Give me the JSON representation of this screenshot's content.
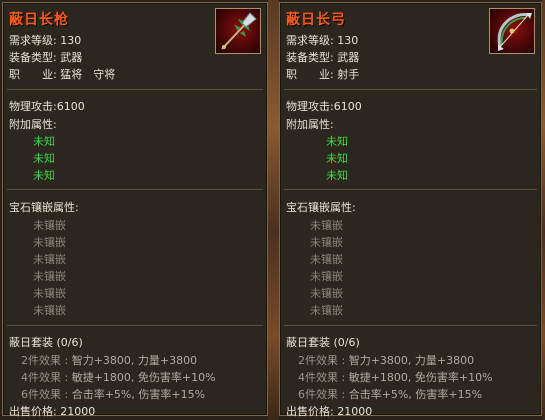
{
  "left": {
    "title": "蔽日长枪",
    "req_label": "需求等级:",
    "req_value": "130",
    "type_label": "装备类型:",
    "type_value": "武器",
    "job_label": "职　　业:",
    "job_value": "猛将　守将",
    "atk_label": "物理攻击:",
    "atk_value": "6100",
    "extra_label": "附加属性:",
    "extra_items": [
      "未知",
      "未知",
      "未知"
    ],
    "gem_label": "宝石镶嵌属性:",
    "gem_items": [
      "未镶嵌",
      "未镶嵌",
      "未镶嵌",
      "未镶嵌",
      "未镶嵌",
      "未镶嵌"
    ],
    "set_title": "蔽日套装 (0/6)",
    "set_effects": [
      {
        "label": "2件效果",
        "value": "智力+3800, 力量+3800"
      },
      {
        "label": "4件效果",
        "value": "敏捷+1800, 免伤害率+10%"
      },
      {
        "label": "6件效果",
        "value": "合击率+5%, 伤害率+15%"
      }
    ],
    "price_label": "出售价格:",
    "price_value": "21000"
  },
  "right": {
    "title": "蔽日长弓",
    "req_label": "需求等级:",
    "req_value": "130",
    "type_label": "装备类型:",
    "type_value": "武器",
    "job_label": "职　　业:",
    "job_value": "射手",
    "atk_label": "物理攻击:",
    "atk_value": "6100",
    "extra_label": "附加属性:",
    "extra_items": [
      "未知",
      "未知",
      "未知"
    ],
    "gem_label": "宝石镶嵌属性:",
    "gem_items": [
      "未镶嵌",
      "未镶嵌",
      "未镶嵌",
      "未镶嵌",
      "未镶嵌",
      "未镶嵌"
    ],
    "set_title": "蔽日套装 (0/6)",
    "set_effects": [
      {
        "label": "2件效果",
        "value": "智力+3800, 力量+3800"
      },
      {
        "label": "4件效果",
        "value": "敏捷+1800, 免伤害率+10%"
      },
      {
        "label": "6件效果",
        "value": "合击率+5%, 伤害率+15%"
      }
    ],
    "price_label": "出售价格:",
    "price_value": "21000"
  },
  "colors": {
    "title": "#ff5a1a",
    "unknown_attr": "#3fd84a",
    "gem_slot": "#8a8478",
    "text": "#e8e2d4"
  },
  "icons": {
    "left": "spear-icon",
    "right": "bow-icon"
  }
}
